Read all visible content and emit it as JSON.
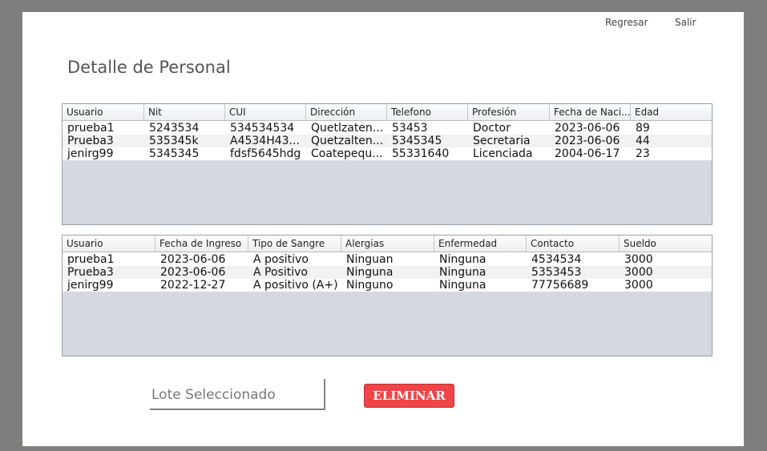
{
  "nav": {
    "back_label": "Regresar",
    "exit_label": "Salir"
  },
  "page": {
    "title": "Detalle de Personal"
  },
  "table1": {
    "columns": [
      "Usuario",
      "Nit",
      "CUI",
      "Dirección",
      "Telefono",
      "Profesión",
      "Fecha de Naci...",
      "Edad"
    ],
    "rows": [
      [
        "prueba1",
        "5243534",
        "534534534",
        "Quetlzaten...",
        "53453",
        "Doctor",
        "2023-06-06",
        "89"
      ],
      [
        "Prueba3",
        "535345k",
        "A4534H43...",
        "Quetzalten...",
        "5345345",
        "Secretaria",
        "2023-06-06",
        "44"
      ],
      [
        "jenirg99",
        "5345345",
        "fdsf5645hdg",
        "Coatepequ...",
        "55331640",
        "Licenciada",
        "2004-06-17",
        "23"
      ]
    ]
  },
  "table2": {
    "columns": [
      "Usuario",
      "Fecha de Ingreso",
      "Tipo de Sangre",
      "Alergias",
      "Enfermedad",
      "Contacto",
      "Sueldo"
    ],
    "rows": [
      [
        "prueba1",
        "2023-06-06",
        "A positivo",
        "Ninguan",
        "Ninguna",
        "4534534",
        "3000"
      ],
      [
        "Prueba3",
        "2023-06-06",
        "A Positivo",
        "Ninguna",
        "Ninguna",
        "5353453",
        "3000"
      ],
      [
        "jenirg99",
        "2022-12-27",
        "A positivo (A+)",
        "Ninguno",
        "Ninguna",
        "77756689",
        "3000"
      ]
    ]
  },
  "form": {
    "lote_label": "Lote Seleccionado",
    "delete_label": "ELIMINAR"
  },
  "colors": {
    "delete_button": "#f04548",
    "table_empty": "#d5d8e0",
    "backdrop": "#7d7f7d"
  }
}
